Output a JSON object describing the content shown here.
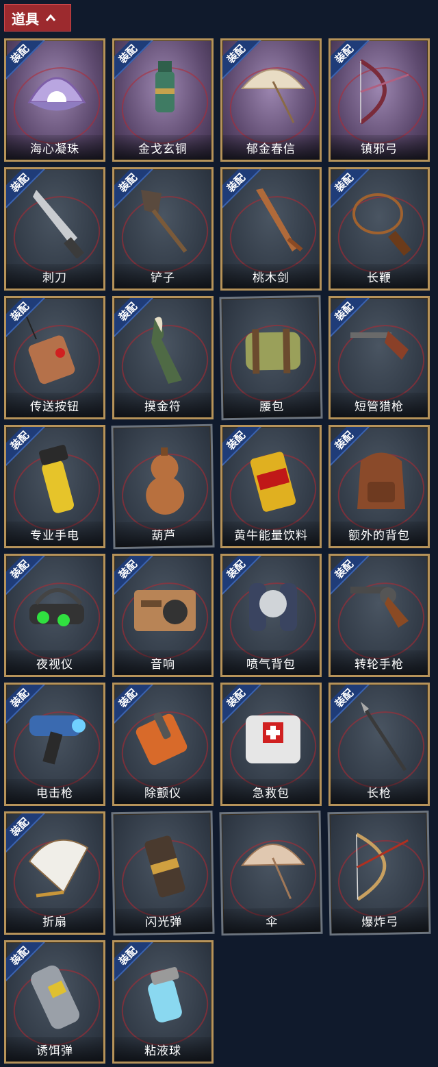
{
  "header": {
    "title": "道具",
    "toggle_icon": "chevron-up-icon"
  },
  "equip_tag": "装配",
  "items": [
    {
      "name": "海心凝珠",
      "icon": "pearl-shell-icon",
      "equip": true,
      "premium": true
    },
    {
      "name": "金戈玄铜",
      "icon": "bronze-grenade-icon",
      "equip": true,
      "premium": true
    },
    {
      "name": "郁金春信",
      "icon": "parasol-icon",
      "equip": true,
      "premium": true
    },
    {
      "name": "镇邪弓",
      "icon": "bow-icon",
      "equip": true,
      "premium": true
    },
    {
      "name": "刺刀",
      "icon": "knife-icon",
      "equip": true,
      "premium": false
    },
    {
      "name": "铲子",
      "icon": "shovel-icon",
      "equip": true,
      "premium": false
    },
    {
      "name": "桃木剑",
      "icon": "wooden-sword-icon",
      "equip": true,
      "premium": false
    },
    {
      "name": "长鞭",
      "icon": "whip-icon",
      "equip": true,
      "premium": false
    },
    {
      "name": "传送按钮",
      "icon": "remote-button-icon",
      "equip": true,
      "premium": false
    },
    {
      "name": "摸金符",
      "icon": "talisman-icon",
      "equip": true,
      "premium": false
    },
    {
      "name": "腰包",
      "icon": "waist-bag-icon",
      "equip": false,
      "premium": false
    },
    {
      "name": "短管猎枪",
      "icon": "shotgun-icon",
      "equip": true,
      "premium": false
    },
    {
      "name": "专业手电",
      "icon": "flashlight-icon",
      "equip": true,
      "premium": false
    },
    {
      "name": "葫芦",
      "icon": "gourd-icon",
      "equip": false,
      "premium": false
    },
    {
      "name": "黄牛能量饮料",
      "icon": "energy-drink-icon",
      "equip": true,
      "premium": false
    },
    {
      "name": "额外的背包",
      "icon": "backpack-icon",
      "equip": true,
      "premium": false
    },
    {
      "name": "夜视仪",
      "icon": "night-vision-icon",
      "equip": true,
      "premium": false
    },
    {
      "name": "音响",
      "icon": "radio-icon",
      "equip": true,
      "premium": false
    },
    {
      "name": "喷气背包",
      "icon": "jetpack-icon",
      "equip": true,
      "premium": false
    },
    {
      "name": "转轮手枪",
      "icon": "revolver-icon",
      "equip": true,
      "premium": false
    },
    {
      "name": "电击枪",
      "icon": "shock-gun-icon",
      "equip": true,
      "premium": false
    },
    {
      "name": "除颤仪",
      "icon": "defibrillator-icon",
      "equip": true,
      "premium": false
    },
    {
      "name": "急救包",
      "icon": "first-aid-kit-icon",
      "equip": true,
      "premium": false
    },
    {
      "name": "长枪",
      "icon": "spear-icon",
      "equip": true,
      "premium": false
    },
    {
      "name": "折扇",
      "icon": "folding-fan-icon",
      "equip": true,
      "premium": false
    },
    {
      "name": "闪光弹",
      "icon": "flashbang-icon",
      "equip": false,
      "premium": false
    },
    {
      "name": "伞",
      "icon": "umbrella-icon",
      "equip": false,
      "premium": false
    },
    {
      "name": "爆炸弓",
      "icon": "explosive-bow-icon",
      "equip": false,
      "premium": false
    },
    {
      "name": "诱饵弹",
      "icon": "decoy-grenade-icon",
      "equip": true,
      "premium": false
    },
    {
      "name": "粘液球",
      "icon": "slime-ball-icon",
      "equip": true,
      "premium": false
    }
  ]
}
